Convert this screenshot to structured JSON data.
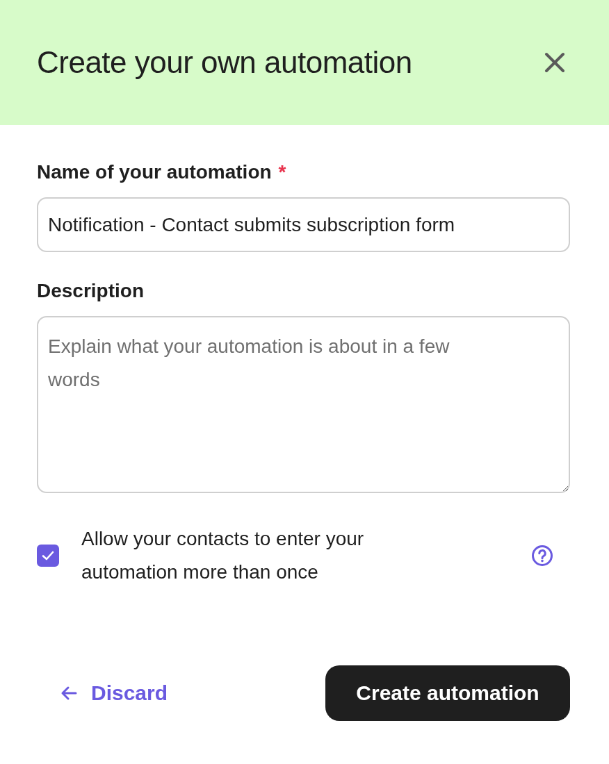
{
  "header": {
    "title": "Create your own automation"
  },
  "name_field": {
    "label": "Name of your automation",
    "required_mark": "*",
    "value": "Notification - Contact submits subscription form"
  },
  "description_field": {
    "label": "Description",
    "placeholder": "Explain what your automation is about in a few words"
  },
  "reentry_option": {
    "label": "Allow your contacts to enter your automation more than once",
    "checked": true
  },
  "footer": {
    "discard": "Discard",
    "submit": "Create automation"
  }
}
